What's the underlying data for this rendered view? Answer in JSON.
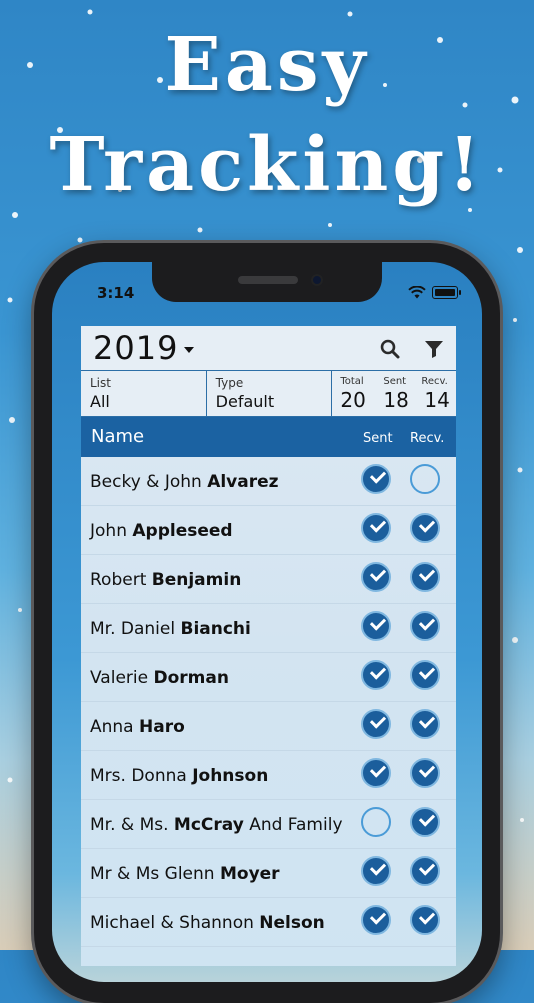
{
  "headline": {
    "line1": "Easy",
    "line2": "Tracking!"
  },
  "status_bar": {
    "time": "3:14"
  },
  "toolbar": {
    "year": "2019"
  },
  "info": {
    "list_label": "List",
    "list_value": "All",
    "type_label": "Type",
    "type_value": "Default",
    "total_label": "Total",
    "total_value": "20",
    "sent_label": "Sent",
    "sent_value": "18",
    "recv_label": "Recv.",
    "recv_value": "14"
  },
  "columns": {
    "name": "Name",
    "sent": "Sent",
    "recv": "Recv."
  },
  "rows": [
    {
      "first": "Becky & John ",
      "last": "Alvarez",
      "suffix": "",
      "sent": true,
      "recv": false
    },
    {
      "first": "John ",
      "last": "Appleseed",
      "suffix": "",
      "sent": true,
      "recv": true
    },
    {
      "first": "Robert ",
      "last": "Benjamin",
      "suffix": "",
      "sent": true,
      "recv": true
    },
    {
      "first": "Mr. Daniel ",
      "last": "Bianchi",
      "suffix": "",
      "sent": true,
      "recv": true
    },
    {
      "first": "Valerie ",
      "last": "Dorman",
      "suffix": "",
      "sent": true,
      "recv": true
    },
    {
      "first": "Anna ",
      "last": "Haro",
      "suffix": "",
      "sent": true,
      "recv": true
    },
    {
      "first": "Mrs. Donna ",
      "last": "Johnson",
      "suffix": "",
      "sent": true,
      "recv": true
    },
    {
      "first": "Mr. & Ms. ",
      "last": "McCray",
      "suffix": " And Family",
      "sent": false,
      "recv": true
    },
    {
      "first": "Mr & Ms Glenn ",
      "last": "Moyer",
      "suffix": "",
      "sent": true,
      "recv": true
    },
    {
      "first": "Michael & Shannon ",
      "last": "Nelson",
      "suffix": "",
      "sent": true,
      "recv": true
    }
  ],
  "icons": {
    "search": "search-icon",
    "filter": "filter-icon",
    "dropdown": "chevron-down-icon",
    "wifi": "wifi-icon",
    "battery": "battery-icon",
    "check": "checkmark-icon"
  },
  "colors": {
    "accent": "#1b62a2",
    "check_fill": "#1b5e9c",
    "background_top": "#2f86c6"
  }
}
